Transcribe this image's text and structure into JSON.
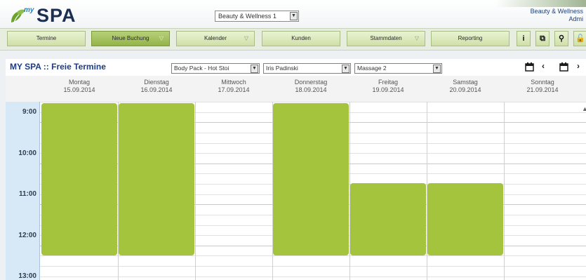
{
  "header": {
    "logo_my": "my",
    "logo_spa": "SPA",
    "workspace_select": "Beauty & Wellness 1",
    "user_workspace": "Beauty & Wellness",
    "user_role": "Admi"
  },
  "nav": {
    "items": [
      {
        "label": "Termine",
        "has_dropdown": false
      },
      {
        "label": "Neue Buchung",
        "has_dropdown": true
      },
      {
        "label": "Kalender",
        "has_dropdown": true
      },
      {
        "label": "Kunden",
        "has_dropdown": false
      },
      {
        "label": "Stammdaten",
        "has_dropdown": true
      },
      {
        "label": "Reporting",
        "has_dropdown": false
      }
    ],
    "active_index": 1,
    "dropdown_glyph": "▽",
    "tools": [
      "i",
      "⧉",
      "⚲",
      "🔓"
    ]
  },
  "toolbar": {
    "title": "MY SPA :: Freie Termine",
    "filters": [
      {
        "value": "Body Pack - Hot Stoi"
      },
      {
        "value": "Iris Padinski"
      },
      {
        "value": "Massage 2"
      }
    ],
    "prev_icon": "‹",
    "next_icon": "›"
  },
  "calendar": {
    "days": [
      {
        "name": "Montag",
        "date": "15.09.2014"
      },
      {
        "name": "Dienstag",
        "date": "16.09.2014"
      },
      {
        "name": "Mittwoch",
        "date": "17.09.2014"
      },
      {
        "name": "Donnerstag",
        "date": "18.09.2014"
      },
      {
        "name": "Freitag",
        "date": "19.09.2014"
      },
      {
        "name": "Samstag",
        "date": "20.09.2014"
      },
      {
        "name": "Sonntag",
        "date": "21.09.2014"
      }
    ],
    "times": [
      "9:00",
      "10:00",
      "11:00",
      "12:00",
      "13:00"
    ],
    "free_slots": [
      {
        "day": 0,
        "start": "9:00",
        "end": "12:30"
      },
      {
        "day": 1,
        "start": "9:00",
        "end": "12:30"
      },
      {
        "day": 3,
        "start": "9:00",
        "end": "12:30"
      },
      {
        "day": 4,
        "start": "10:45",
        "end": "12:30"
      },
      {
        "day": 5,
        "start": "10:45",
        "end": "12:30"
      }
    ],
    "slot_color": "#a3c43c",
    "time_column_color": "#d7e8f6"
  }
}
